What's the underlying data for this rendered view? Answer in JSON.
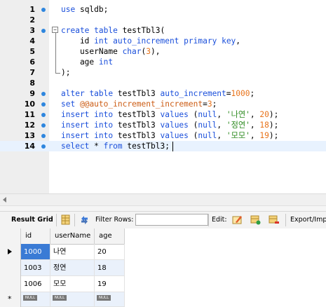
{
  "editor": {
    "lines": [
      {
        "num": "1",
        "marker": true,
        "tokens": [
          {
            "t": "use",
            "c": "kw"
          },
          {
            "t": " sqldb;",
            "c": "pl"
          }
        ]
      },
      {
        "num": "2",
        "marker": false,
        "tokens": []
      },
      {
        "num": "3",
        "marker": true,
        "fold": "−",
        "tokens": [
          {
            "t": "create",
            "c": "kw"
          },
          {
            "t": " ",
            "c": "pl"
          },
          {
            "t": "table",
            "c": "kw"
          },
          {
            "t": " testTbl3(",
            "c": "pl"
          }
        ]
      },
      {
        "num": "4",
        "marker": false,
        "tokens": [
          {
            "t": "    id ",
            "c": "pl"
          },
          {
            "t": "int",
            "c": "kw"
          },
          {
            "t": " ",
            "c": "pl"
          },
          {
            "t": "auto_increment",
            "c": "kw"
          },
          {
            "t": " ",
            "c": "pl"
          },
          {
            "t": "primary",
            "c": "kw"
          },
          {
            "t": " ",
            "c": "pl"
          },
          {
            "t": "key",
            "c": "kw"
          },
          {
            "t": ",",
            "c": "pl"
          }
        ]
      },
      {
        "num": "5",
        "marker": false,
        "tokens": [
          {
            "t": "    userName ",
            "c": "pl"
          },
          {
            "t": "char",
            "c": "kw"
          },
          {
            "t": "(",
            "c": "pl"
          },
          {
            "t": "3",
            "c": "num"
          },
          {
            "t": "),",
            "c": "pl"
          }
        ]
      },
      {
        "num": "6",
        "marker": false,
        "tokens": [
          {
            "t": "    age ",
            "c": "pl"
          },
          {
            "t": "int",
            "c": "kw"
          }
        ]
      },
      {
        "num": "7",
        "marker": false,
        "foldEnd": true,
        "tokens": [
          {
            "t": ");",
            "c": "pl"
          }
        ]
      },
      {
        "num": "8",
        "marker": false,
        "tokens": []
      },
      {
        "num": "9",
        "marker": true,
        "tokens": [
          {
            "t": "alter",
            "c": "kw"
          },
          {
            "t": " ",
            "c": "pl"
          },
          {
            "t": "table",
            "c": "kw"
          },
          {
            "t": " testTbl3 ",
            "c": "pl"
          },
          {
            "t": "auto_increment",
            "c": "kw"
          },
          {
            "t": "=",
            "c": "pl"
          },
          {
            "t": "1000",
            "c": "num"
          },
          {
            "t": ";",
            "c": "pl"
          }
        ]
      },
      {
        "num": "10",
        "marker": true,
        "tokens": [
          {
            "t": "set",
            "c": "kw"
          },
          {
            "t": " ",
            "c": "pl"
          },
          {
            "t": "@@auto_increment_increment",
            "c": "sysvar"
          },
          {
            "t": "=",
            "c": "pl"
          },
          {
            "t": "3",
            "c": "num"
          },
          {
            "t": ";",
            "c": "pl"
          }
        ]
      },
      {
        "num": "11",
        "marker": true,
        "tokens": [
          {
            "t": "insert",
            "c": "kw"
          },
          {
            "t": " ",
            "c": "pl"
          },
          {
            "t": "into",
            "c": "kw"
          },
          {
            "t": " testTbl3 ",
            "c": "pl"
          },
          {
            "t": "values",
            "c": "kw"
          },
          {
            "t": " (",
            "c": "pl"
          },
          {
            "t": "null",
            "c": "kw"
          },
          {
            "t": ", ",
            "c": "pl"
          },
          {
            "t": "'나연'",
            "c": "str"
          },
          {
            "t": ", ",
            "c": "pl"
          },
          {
            "t": "20",
            "c": "num"
          },
          {
            "t": ");",
            "c": "pl"
          }
        ]
      },
      {
        "num": "12",
        "marker": true,
        "tokens": [
          {
            "t": "insert",
            "c": "kw"
          },
          {
            "t": " ",
            "c": "pl"
          },
          {
            "t": "into",
            "c": "kw"
          },
          {
            "t": " testTbl3 ",
            "c": "pl"
          },
          {
            "t": "values",
            "c": "kw"
          },
          {
            "t": " (",
            "c": "pl"
          },
          {
            "t": "null",
            "c": "kw"
          },
          {
            "t": ", ",
            "c": "pl"
          },
          {
            "t": "'정연'",
            "c": "str"
          },
          {
            "t": ", ",
            "c": "pl"
          },
          {
            "t": "18",
            "c": "num"
          },
          {
            "t": ");",
            "c": "pl"
          }
        ]
      },
      {
        "num": "13",
        "marker": true,
        "tokens": [
          {
            "t": "insert",
            "c": "kw"
          },
          {
            "t": " ",
            "c": "pl"
          },
          {
            "t": "into",
            "c": "kw"
          },
          {
            "t": " testTbl3 ",
            "c": "pl"
          },
          {
            "t": "values",
            "c": "kw"
          },
          {
            "t": " (",
            "c": "pl"
          },
          {
            "t": "null",
            "c": "kw"
          },
          {
            "t": ", ",
            "c": "pl"
          },
          {
            "t": "'모모'",
            "c": "str"
          },
          {
            "t": ", ",
            "c": "pl"
          },
          {
            "t": "19",
            "c": "num"
          },
          {
            "t": ");",
            "c": "pl"
          }
        ]
      },
      {
        "num": "14",
        "marker": true,
        "current": true,
        "tokens": [
          {
            "t": "select",
            "c": "kw"
          },
          {
            "t": " * ",
            "c": "pl"
          },
          {
            "t": "from",
            "c": "kw"
          },
          {
            "t": " testTbl3;",
            "c": "pl"
          }
        ]
      }
    ]
  },
  "toolbar": {
    "result_grid_label": "Result Grid",
    "filter_rows_label": "Filter Rows:",
    "filter_rows_value": "",
    "edit_label": "Edit:",
    "export_label": "Export/Imp"
  },
  "grid": {
    "columns": [
      "id",
      "userName",
      "age"
    ],
    "rows": [
      {
        "id": "1000",
        "userName": "나연",
        "age": "20",
        "selected": true,
        "current": true
      },
      {
        "id": "1003",
        "userName": "정연",
        "age": "18"
      },
      {
        "id": "1006",
        "userName": "모모",
        "age": "19"
      }
    ],
    "null_label": "NULL"
  },
  "colors": {
    "keyword": "#1a4fdb",
    "string": "#2b8a1e",
    "number": "#e8731a",
    "selection": "#3a7bd5"
  }
}
